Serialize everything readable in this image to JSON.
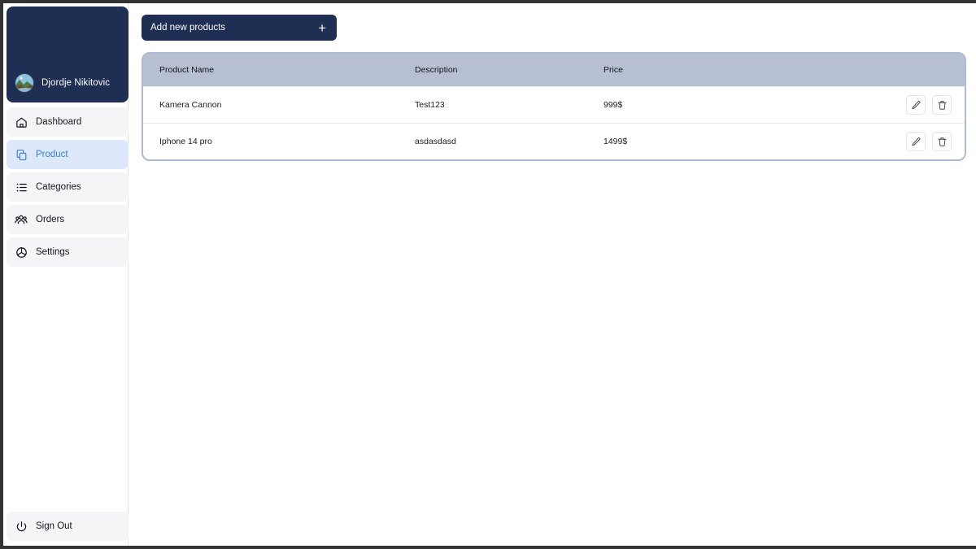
{
  "window": {
    "frame_color": "#333336"
  },
  "sidebar": {
    "profile": {
      "name": "Djordje Nikitovic",
      "avatar_icon": "landscape-photo-avatar",
      "card_color": "#1e2f53"
    },
    "items": [
      {
        "label": "Dashboard",
        "icon": "home-icon",
        "active": false
      },
      {
        "label": "Product",
        "icon": "copy-icon",
        "active": true
      },
      {
        "label": "Categories",
        "icon": "list-icon",
        "active": false
      },
      {
        "label": "Orders",
        "icon": "people-icon",
        "active": false
      },
      {
        "label": "Settings",
        "icon": "pie-gear-icon",
        "active": false
      }
    ],
    "signout": {
      "label": "Sign Out",
      "icon": "power-icon"
    },
    "active_color": "#3b7ddd",
    "active_bg": "#dde9fb",
    "item_bg": "#f4f5f7"
  },
  "toolbar": {
    "add_label": "Add new products",
    "add_plus": "+",
    "add_bg": "#1e2f53"
  },
  "table": {
    "header_bg": "#b7c0d3",
    "border_color": "#aeb9d2",
    "columns": [
      "Product Name",
      "Description",
      "Price"
    ],
    "rows": [
      {
        "name": "Kamera Cannon",
        "description": "Test123",
        "price": "999$"
      },
      {
        "name": "Iphone 14 pro",
        "description": "asdasdasd",
        "price": "1499$"
      }
    ],
    "actions": {
      "edit_icon": "pencil-icon",
      "delete_icon": "trash-icon"
    }
  }
}
